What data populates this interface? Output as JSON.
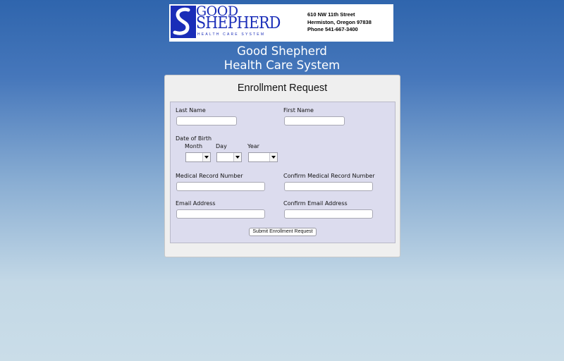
{
  "header": {
    "logo": {
      "line1": "GOOD",
      "line2": "SHEPHERD",
      "tagline": "HEALTH CARE SYSTEM",
      "brand_color": "#1a2db8"
    },
    "address": {
      "street": "610 NW 11th Street",
      "city": "Hermiston, Oregon 97838",
      "phone": "Phone 541-667-3400"
    },
    "title_line1": "Good Shepherd",
    "title_line2": "Health Care System"
  },
  "form": {
    "title": "Enrollment Request",
    "last_name": {
      "label": "Last Name",
      "value": ""
    },
    "first_name": {
      "label": "First Name",
      "value": ""
    },
    "dob": {
      "label": "Date of Birth",
      "month_label": "Month",
      "day_label": "Day",
      "year_label": "Year",
      "month_value": "",
      "day_value": "",
      "year_value": ""
    },
    "mrn": {
      "label": "Medical Record Number",
      "value": ""
    },
    "confirm_mrn": {
      "label": "Confirm Medical Record Number",
      "value": ""
    },
    "email": {
      "label": "Email Address",
      "value": ""
    },
    "confirm_email": {
      "label": "Confirm Email Address",
      "value": ""
    },
    "submit_label": "Submit Enrollment Request"
  }
}
